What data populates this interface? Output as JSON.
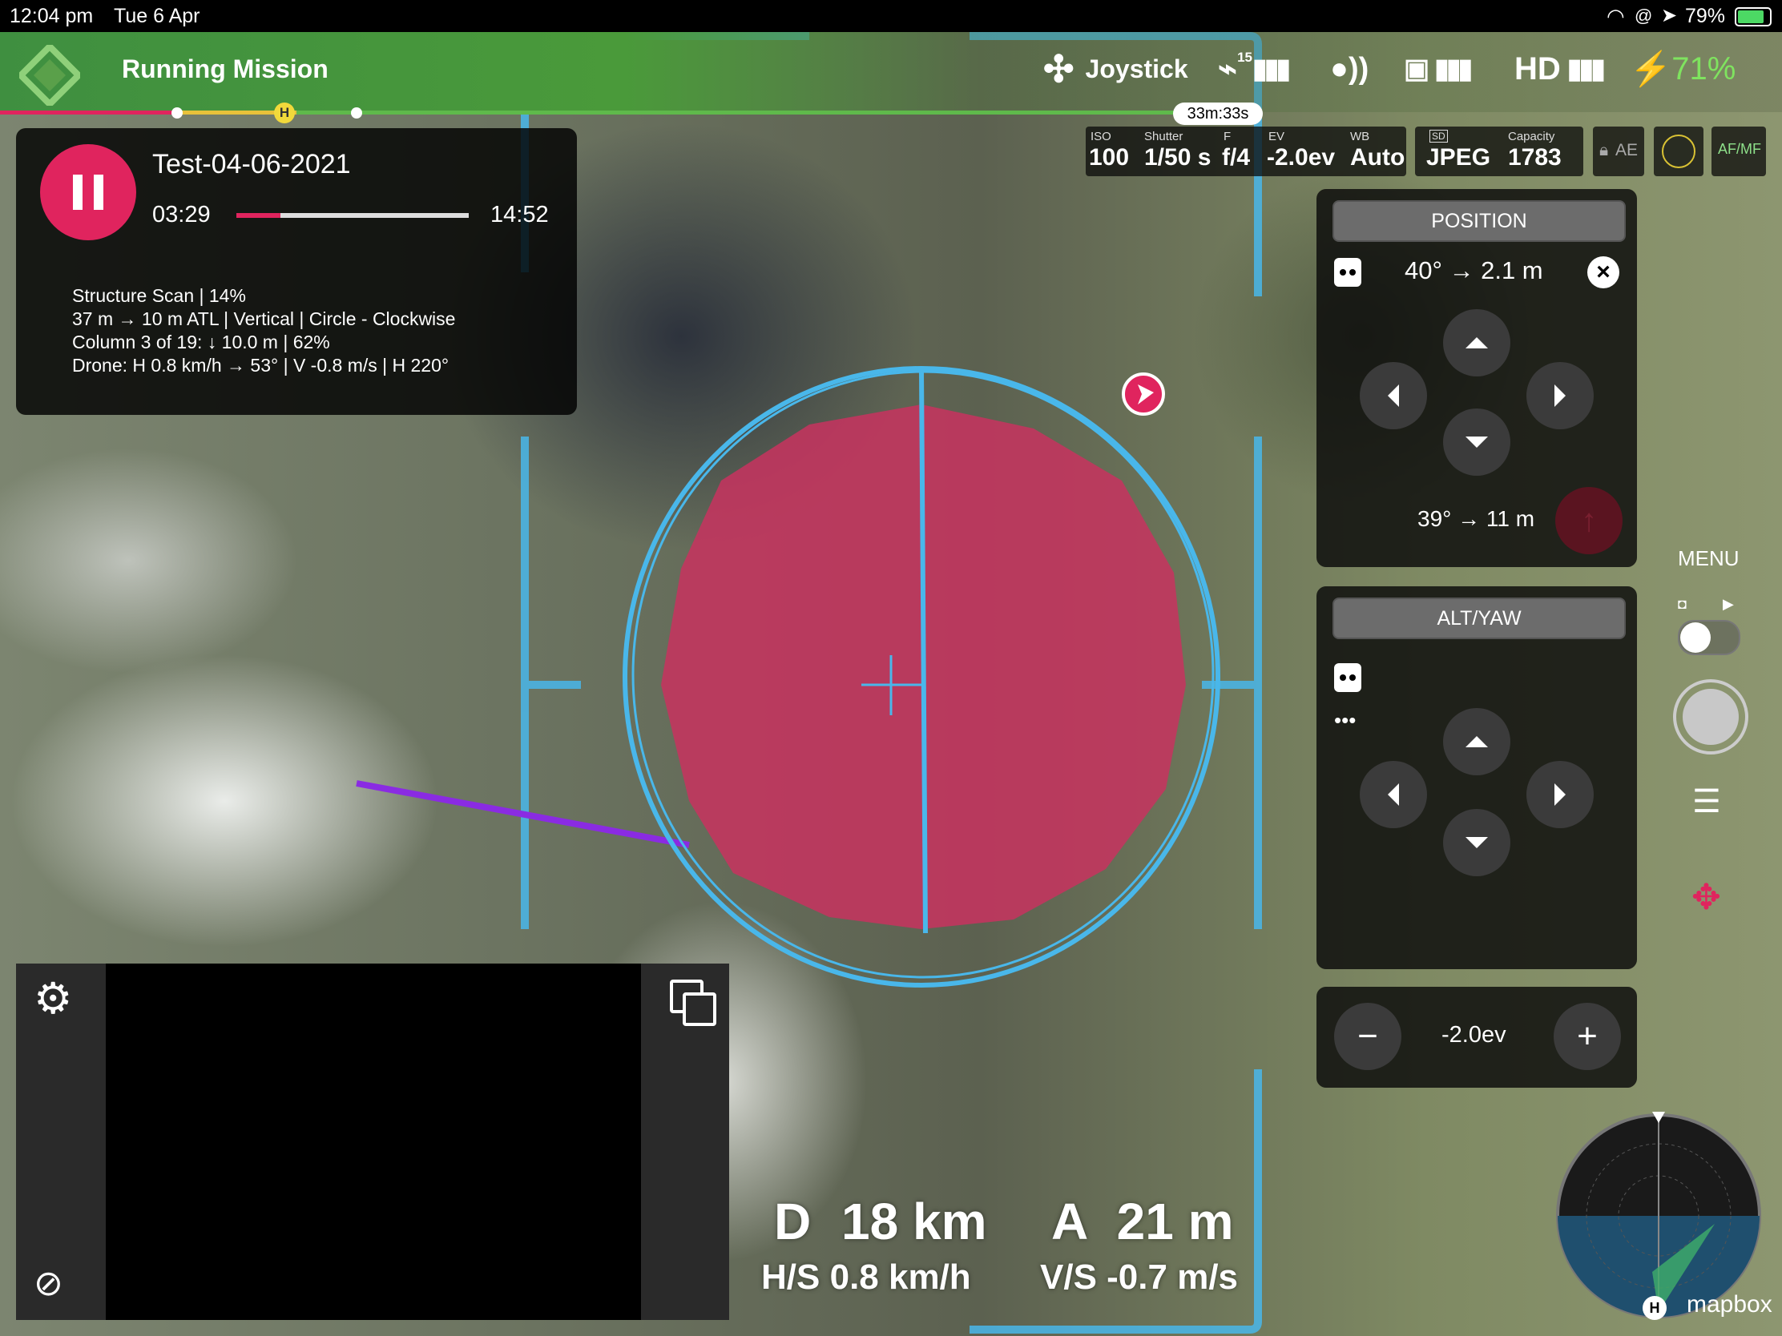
{
  "status_bar": {
    "time": "12:04 pm",
    "date": "Tue 6 Apr",
    "battery": "79%"
  },
  "header": {
    "title": "Running Mission",
    "mode": "Joystick",
    "satellites": "15",
    "video_quality": "HD",
    "drone_battery": "71%",
    "flight_time": "33m:33s",
    "home_marker": "H"
  },
  "mission": {
    "name": "Test-04-06-2021",
    "elapsed": "03:29",
    "remaining": "14:52",
    "progress": 0.19,
    "details": [
      "Structure Scan | 14%",
      "37 m → 10 m ATL | Vertical | Circle - Clockwise",
      "Column 3 of 19: ↓ 10.0 m | 62%",
      "Drone: H 0.8 km/h → 53° | V -0.8 m/s | H 220°"
    ]
  },
  "camera": {
    "iso_label": "ISO",
    "iso": "100",
    "shutter_label": "Shutter",
    "shutter": "1/50 s",
    "f_label": "F",
    "aperture": "f/4",
    "ev_label": "EV",
    "ev": "-2.0ev",
    "wb_label": "WB",
    "wb": "Auto",
    "sd_label": "SD",
    "format": "JPEG",
    "capacity_label": "Capacity",
    "capacity": "1783",
    "ae": "AE",
    "afmf": "AF/MF"
  },
  "position_panel": {
    "title": "POSITION",
    "top_value": "40° → 2.1 m",
    "bottom_value": "39° → 11 m"
  },
  "altyaw_panel": {
    "title": "ALT/YAW",
    "dots": "•••"
  },
  "exposure_panel": {
    "value": "-2.0ev",
    "minus": "−",
    "plus": "+"
  },
  "side_menu": {
    "menu_label": "MENU"
  },
  "telemetry": {
    "distance_label": "D",
    "distance": "18 km",
    "hspeed_label": "H/S",
    "hspeed": "0.8 km/h",
    "altitude_label": "A",
    "altitude": "21 m",
    "vspeed_label": "V/S",
    "vspeed": "-0.7 m/s"
  },
  "map": {
    "home_marker": "H",
    "attribution": "mapbox"
  },
  "colors": {
    "accent_red": "#e0245e",
    "hud_blue": "#49b7ea",
    "header_green": "#4a9a3a",
    "target_magenta": "#c8325f"
  }
}
